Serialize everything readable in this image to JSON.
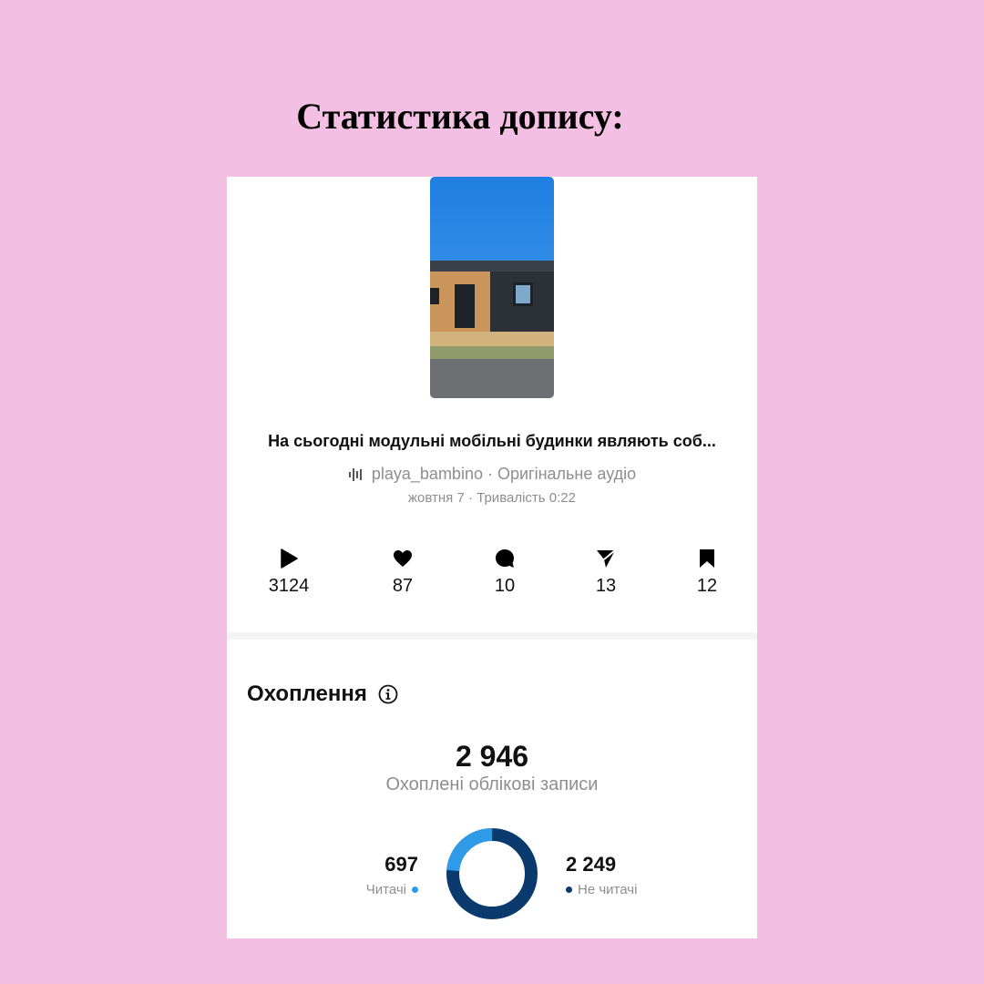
{
  "page": {
    "title": "Статистика допису:"
  },
  "post": {
    "caption": "На сьогодні модульні мобільні будинки являють соб...",
    "audio_icon": "audio-wave-icon",
    "username": "playa_bambino",
    "audio": "Оригінальне аудіо",
    "audio_separator": " · ",
    "meta": "жовтня 7 · Тривалість 0:22"
  },
  "stats": [
    {
      "icon": "play-icon",
      "value": "3124"
    },
    {
      "icon": "heart-icon",
      "value": "87"
    },
    {
      "icon": "comment-icon",
      "value": "10"
    },
    {
      "icon": "share-icon",
      "value": "13"
    },
    {
      "icon": "bookmark-icon",
      "value": "12"
    }
  ],
  "reach": {
    "title": "Охоплення",
    "info_icon": "info-icon",
    "total": "2 946",
    "total_label": "Охоплені облікові записи",
    "followers": {
      "value": "697",
      "label": "Читачі",
      "fraction": 0.237,
      "color": "#2f9be8"
    },
    "non_followers": {
      "value": "2 249",
      "label": "Не читачі",
      "fraction": 0.763,
      "color": "#0b3a6e"
    }
  }
}
